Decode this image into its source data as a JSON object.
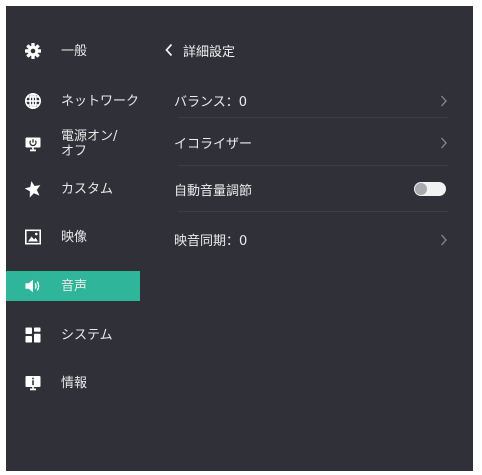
{
  "sidebar": {
    "items": [
      {
        "label": "一般",
        "icon": "gear-icon"
      },
      {
        "label": "ネットワーク",
        "icon": "globe-icon"
      },
      {
        "label": "電源オン/\nオフ",
        "icon": "monitor-power-icon"
      },
      {
        "label": "カスタム",
        "icon": "star-icon"
      },
      {
        "label": "映像",
        "icon": "picture-icon"
      },
      {
        "label": "音声",
        "icon": "speaker-icon"
      },
      {
        "label": "システム",
        "icon": "system-grid-icon"
      },
      {
        "label": "情報",
        "icon": "info-monitor-icon"
      }
    ],
    "active_label": "音声"
  },
  "header": {
    "back_icon": "chevron-left-icon",
    "title": "詳細設定"
  },
  "settings": {
    "balance": {
      "label": "バランス：0"
    },
    "equalizer": {
      "label": "イコライザー"
    },
    "auto_volume": {
      "label": "自動音量調節",
      "enabled": false
    },
    "av_sync": {
      "label": "映音同期：0"
    }
  },
  "colors": {
    "background": "#303138",
    "accent": "#2fb69a",
    "text": "#e8e8e8",
    "toggle_track": "#f2f2f2",
    "toggle_knob": "#a9aab0"
  }
}
